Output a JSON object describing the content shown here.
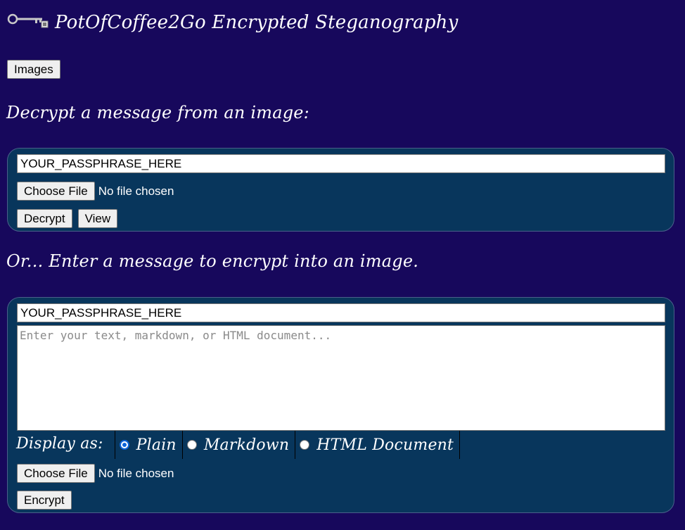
{
  "app": {
    "title": "PotOfCoffee2Go Encrypted Steganography",
    "logo_icon": "key-icon"
  },
  "nav": {
    "images_label": "Images"
  },
  "decrypt": {
    "heading": "Decrypt a message from an image:",
    "passphrase": "YOUR_PASSPHRASE_HERE",
    "choose_file_label": "Choose File",
    "file_status": "No file chosen",
    "decrypt_label": "Decrypt",
    "view_label": "View"
  },
  "encrypt": {
    "heading": "Or... Enter a message to encrypt into an image.",
    "passphrase": "YOUR_PASSPHRASE_HERE",
    "message_placeholder": "Enter your text, markdown, or HTML document...",
    "display_as_label": "Display as:",
    "display_options": [
      "Plain",
      "Markdown",
      "HTML Document"
    ],
    "selected_display": "Plain",
    "choose_file_label": "Choose File",
    "file_status": "No file chosen",
    "encrypt_label": "Encrypt"
  },
  "colors": {
    "background": "#17085c",
    "panel": "#08365c",
    "radio_selected": "#0b63d9"
  }
}
